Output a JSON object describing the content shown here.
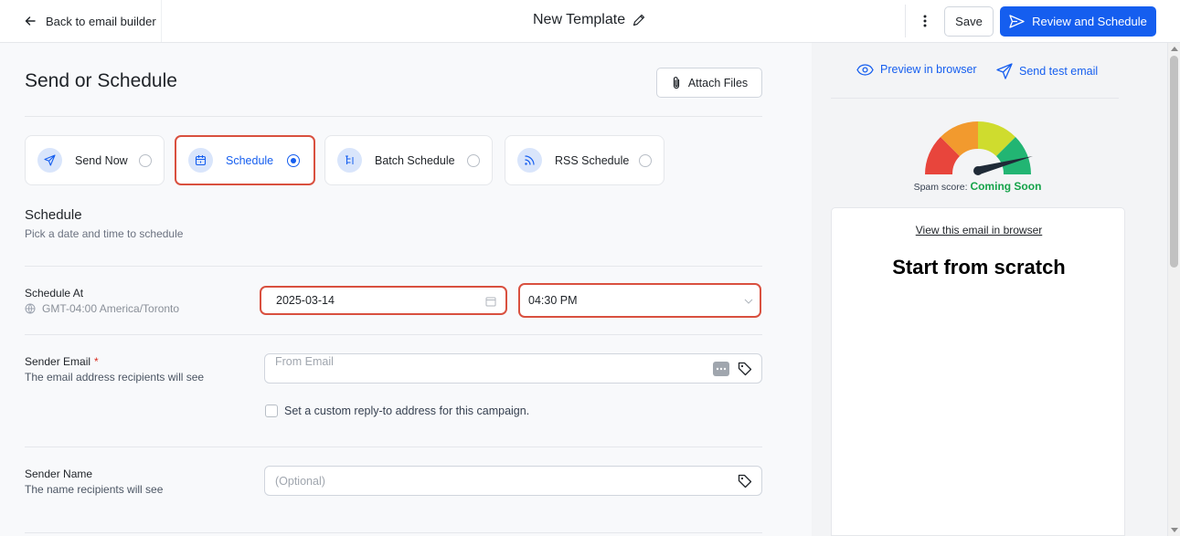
{
  "header": {
    "back_label": "Back to email builder",
    "template_title": "New Template",
    "save_label": "Save",
    "review_label": "Review and Schedule"
  },
  "page": {
    "title": "Send or Schedule",
    "attach_label": "Attach Files"
  },
  "send_options": [
    {
      "label": "Send Now",
      "icon": "send-icon",
      "selected": false
    },
    {
      "label": "Schedule",
      "icon": "calendar-icon",
      "selected": true
    },
    {
      "label": "Batch Schedule",
      "icon": "batch-icon",
      "selected": false
    },
    {
      "label": "RSS Schedule",
      "icon": "rss-icon",
      "selected": false
    }
  ],
  "schedule": {
    "title": "Schedule",
    "subtitle": "Pick a date and time to schedule",
    "schedule_at_label": "Schedule At",
    "timezone": "GMT-04:00 America/Toronto",
    "date_value": "2025-03-14",
    "time_value": "04:30 PM"
  },
  "sender_email": {
    "label": "Sender Email",
    "required_mark": "*",
    "sublabel": "The email address recipients will see",
    "placeholder": "From Email",
    "custom_reply_label": "Set a custom reply-to address for this campaign."
  },
  "sender_name": {
    "label": "Sender Name",
    "sublabel": "The name recipients will see",
    "placeholder": "(Optional)"
  },
  "preview": {
    "preview_link": "Preview in browser",
    "test_link": "Send test email",
    "spam_label": "Spam score:",
    "spam_value": "Coming Soon",
    "view_link": "View this email in browser",
    "email_heading": "Start from scratch"
  },
  "colors": {
    "accent": "#155eef",
    "highlight": "#d9503f",
    "spam_value": "#16a34a"
  }
}
